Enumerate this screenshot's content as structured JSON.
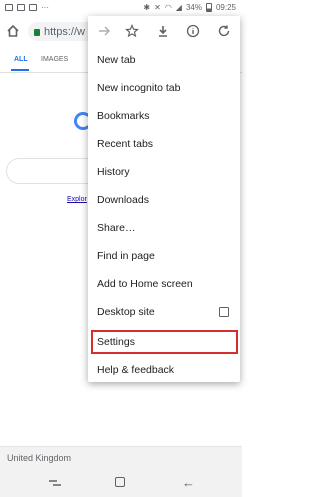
{
  "status": {
    "battery": "34%",
    "time": "09:25"
  },
  "toolbar": {
    "url": "https://w"
  },
  "results": {
    "tabs": [
      "ALL",
      "IMAGES"
    ],
    "explore_link": "Explor"
  },
  "footer": {
    "location": "United Kingdom"
  },
  "menu": {
    "icons": [
      "forward-icon",
      "star-icon",
      "download-icon",
      "info-icon",
      "refresh-icon"
    ],
    "items": [
      "New tab",
      "New incognito tab",
      "Bookmarks",
      "Recent tabs",
      "History",
      "Downloads",
      "Share…",
      "Find in page",
      "Add to Home screen",
      "Desktop site",
      "Settings",
      "Help & feedback"
    ],
    "desktop_site_checked": false,
    "highlighted_item": "Settings"
  },
  "colors": {
    "highlight_border": "#d32f2f",
    "link_blue": "#1a73e8",
    "secure_green": "#188038"
  }
}
